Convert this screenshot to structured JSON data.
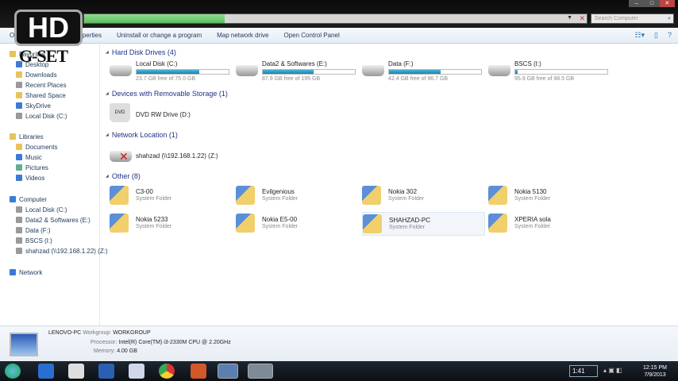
{
  "watermark": {
    "hd": "HD",
    "brand": "G-SET"
  },
  "search": {
    "placeholder": "Search Computer"
  },
  "toolbar": {
    "items": [
      "Organize",
      "System properties",
      "Uninstall or change a program",
      "Map network drive",
      "Open Control Panel"
    ]
  },
  "sidebar": {
    "favorites": "Favorites",
    "fav_items": [
      "Desktop",
      "Downloads",
      "Recent Places",
      "Shared Space",
      "SkyDrive",
      "Local Disk (C:)"
    ],
    "libraries": "Libraries",
    "lib_items": [
      "Documents",
      "Music",
      "Pictures",
      "Videos"
    ],
    "computer": "Computer",
    "comp_items": [
      "Local Disk (C:)",
      "Data2 & Softwares (E:)",
      "Data (F:)",
      "BSCS (I:)",
      "shahzad (\\\\192.168.1.22) (Z:)"
    ],
    "network": "Network"
  },
  "groups": {
    "hdd": "Hard Disk Drives (4)",
    "removable": "Devices with Removable Storage (1)",
    "network": "Network Location (1)",
    "other": "Other (8)"
  },
  "drives": [
    {
      "name": "Local Disk (C:)",
      "free": "23.7 GB free of 75.0 GB",
      "used_fraction": 0.68
    },
    {
      "name": "Data2 & Softwares (E:)",
      "free": "87.9 GB free of 195 GB",
      "used_fraction": 0.55
    },
    {
      "name": "Data (F:)",
      "free": "42.4 GB free of 96.7 GB",
      "used_fraction": 0.56
    },
    {
      "name": "BSCS (I:)",
      "free": "95.9 GB free of 98.5 GB",
      "used_fraction": 0.03
    }
  ],
  "removable": {
    "name": "DVD RW Drive (D:)",
    "icon_label": "DVD"
  },
  "netloc": {
    "name": "shahzad (\\\\192.168.1.22) (Z:)"
  },
  "other": [
    {
      "name": "C3-00",
      "sub": "System Folder"
    },
    {
      "name": "Evilgenious",
      "sub": "System Folder"
    },
    {
      "name": "Nokia 302",
      "sub": "System Folder"
    },
    {
      "name": "Nokia 5130",
      "sub": "System Folder"
    },
    {
      "name": "Nokia 5233",
      "sub": "System Folder"
    },
    {
      "name": "Nokia E5-00",
      "sub": "System Folder"
    },
    {
      "name": "SHAHZAD-PC",
      "sub": "System Folder"
    },
    {
      "name": "XPERIA sola",
      "sub": "System Folder"
    }
  ],
  "details": {
    "pc": "LENOVO-PC",
    "wg_label": "Workgroup:",
    "wg": "WORKGROUP",
    "proc_label": "Processor:",
    "proc": "Intel(R) Core(TM) i3-2330M CPU @ 2.20GHz",
    "mem_label": "Memory:",
    "mem": "4.00 GB"
  },
  "taskbar": {
    "timer": "1:41",
    "time": "12:15 PM",
    "date": "7/9/2013"
  },
  "address_progress": 0.28
}
